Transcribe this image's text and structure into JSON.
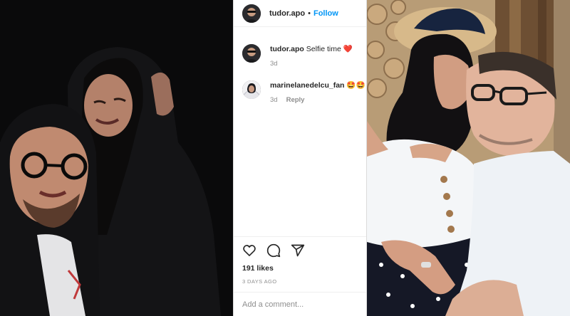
{
  "post": {
    "username": "tudor.apo",
    "follow_label": "Follow",
    "dot": "•"
  },
  "comments": [
    {
      "username": "tudor.apo",
      "text": "Selfie time",
      "emoji": "❤️",
      "age": "3d"
    },
    {
      "username": "marinelanedelcu_fan",
      "text": "",
      "emoji": "🤩🤩",
      "age": "3d",
      "reply_label": "Reply"
    }
  ],
  "actions": {
    "like_icon": "heart-icon",
    "comment_icon": "comment-bubble-icon",
    "share_icon": "paper-plane-icon"
  },
  "likes": "191 likes",
  "timestamp": "3 DAYS AGO",
  "comment_input": {
    "placeholder": "Add a comment..."
  },
  "colors": {
    "link_blue": "#0095f6",
    "text_dark": "#262626",
    "text_muted": "#8e8e8e",
    "border": "#dbdbdb"
  }
}
